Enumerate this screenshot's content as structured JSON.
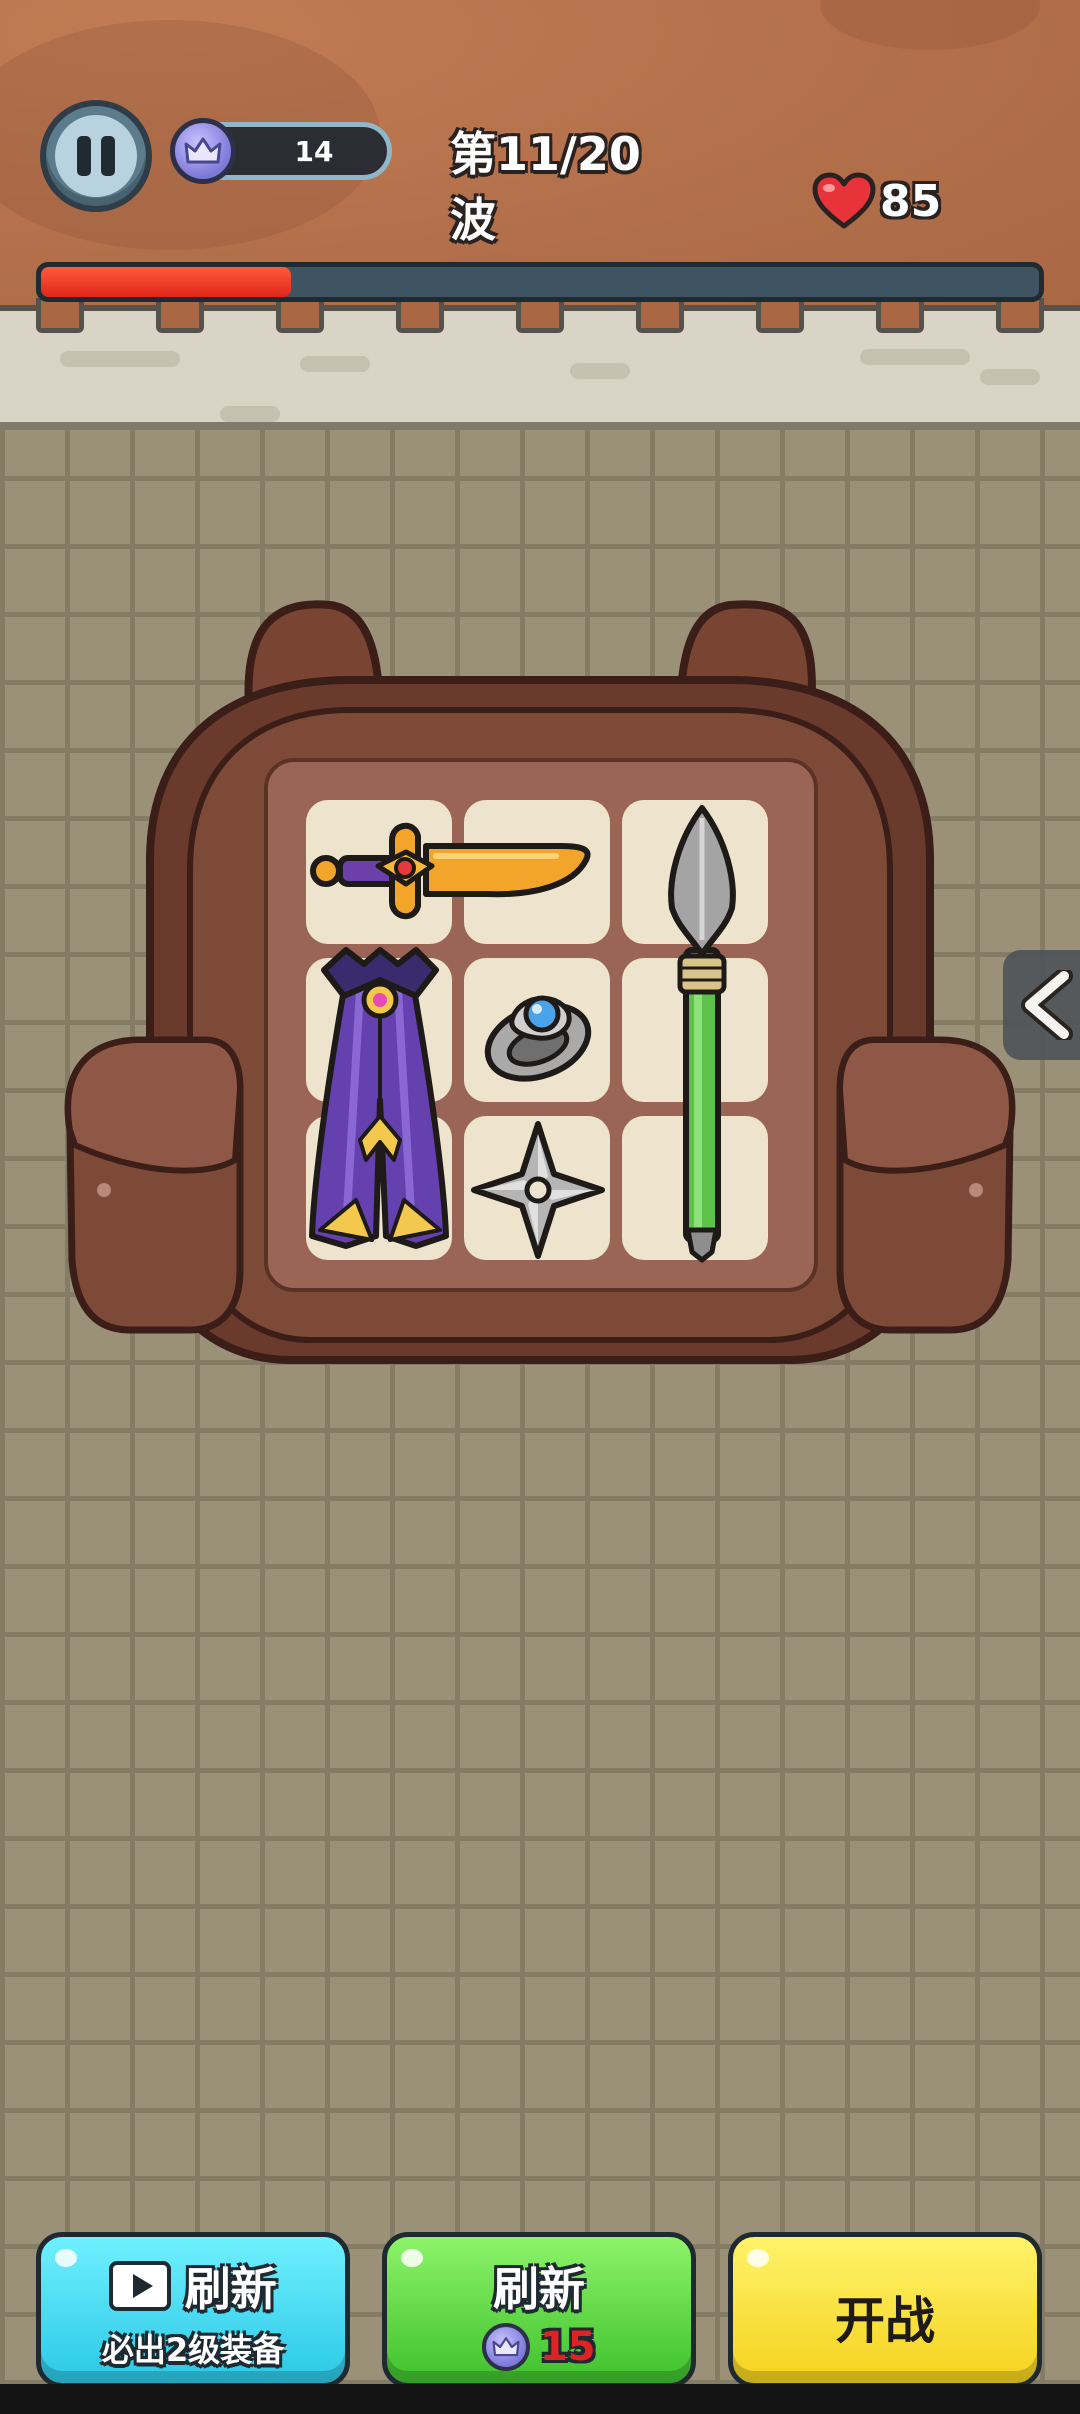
{
  "hud": {
    "gem_count": "14",
    "wave_label": "第11/20波",
    "hp": "85",
    "wave_progress": 0.25
  },
  "backpack": {
    "items": [
      {
        "name": "golden-sword",
        "slots": "row1 col1-2"
      },
      {
        "name": "spear",
        "slots": "col3 rows1-3"
      },
      {
        "name": "purple-cape",
        "slots": "col1 rows2-3"
      },
      {
        "name": "silver-ring",
        "slots": "row2 col2"
      },
      {
        "name": "shuriken",
        "slots": "row3 col2"
      }
    ]
  },
  "buttons": {
    "ad_refresh": {
      "title": "刷新",
      "subtitle": "必出2级装备",
      "icon": "video-play-icon"
    },
    "gem_refresh": {
      "title": "刷新",
      "cost": "15",
      "icon": "gem-icon"
    },
    "start": {
      "title": "开战"
    }
  },
  "colors": {
    "progress_fill": "#e0261a",
    "cost_text": "#e02222",
    "ad_button": "#2bc8e6",
    "refresh_button": "#3fc12d",
    "start_button": "#f5d21e"
  }
}
